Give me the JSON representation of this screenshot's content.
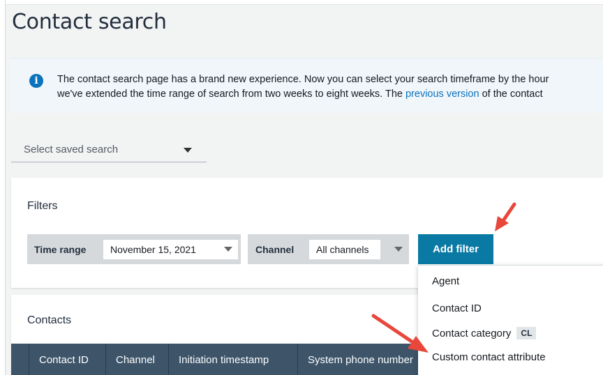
{
  "page": {
    "title": "Contact search"
  },
  "banner": {
    "line1": "The contact search page has a brand new experience. Now you can select your search timeframe by the hour",
    "line2_before": "we've extended the time range of search from two weeks to eight weeks. The ",
    "line2_link": "previous version",
    "line2_after": " of the contact"
  },
  "saved_search": {
    "placeholder": "Select saved search"
  },
  "filters": {
    "title": "Filters",
    "time_range": {
      "label": "Time range",
      "value": "November 15, 2021"
    },
    "channel": {
      "label": "Channel",
      "value": "All channels"
    },
    "add_filter_label": "Add filter"
  },
  "add_filter_menu": {
    "items": [
      {
        "label": "Agent"
      },
      {
        "label": "Contact ID"
      },
      {
        "label": "Contact category",
        "badge": "CL"
      },
      {
        "label": "Custom contact attribute"
      }
    ]
  },
  "contacts": {
    "title": "Contacts",
    "columns": [
      "Contact ID",
      "Channel",
      "Initiation timestamp",
      "System phone number"
    ]
  },
  "colors": {
    "primary_button": "#0a7aa4",
    "info_banner": "#f1f6fb",
    "info_icon": "#0b73bb",
    "table_header": "#3d5469",
    "annotation_arrow": "#e8473b"
  }
}
